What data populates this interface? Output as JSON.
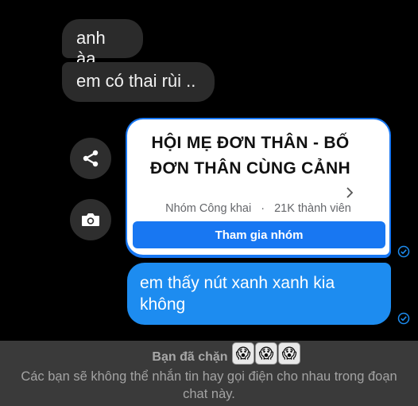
{
  "messages": [
    {
      "text": "anh àa",
      "direction": "incoming"
    },
    {
      "text": "em có thai rùi ..",
      "direction": "incoming"
    },
    {
      "text": "em thấy nút xanh xanh kia không",
      "direction": "outgoing"
    }
  ],
  "group_card": {
    "title": "HỘI MẸ ĐƠN THÂN - BỐ ĐƠN THÂN CÙNG CẢNH",
    "privacy": "Nhóm Công khai",
    "separator": "·",
    "members": "21K thành viên",
    "join_label": "Tham gia nhóm"
  },
  "side_icons": [
    "share-icon",
    "camera-icon"
  ],
  "blocked": {
    "title": "Bạn đã chặn",
    "emojis": [
      "😱",
      "😱",
      "😱"
    ],
    "text": "Các bạn sẽ không thể nhắn tin hay gọi điện cho nhau trong đoạn chat này."
  },
  "colors": {
    "background": "#000000",
    "incoming_bubble": "#2b2b2b",
    "outgoing_bubble": "#1d8cf0",
    "accent": "#1877f2",
    "banner": "#3a3a3a"
  }
}
